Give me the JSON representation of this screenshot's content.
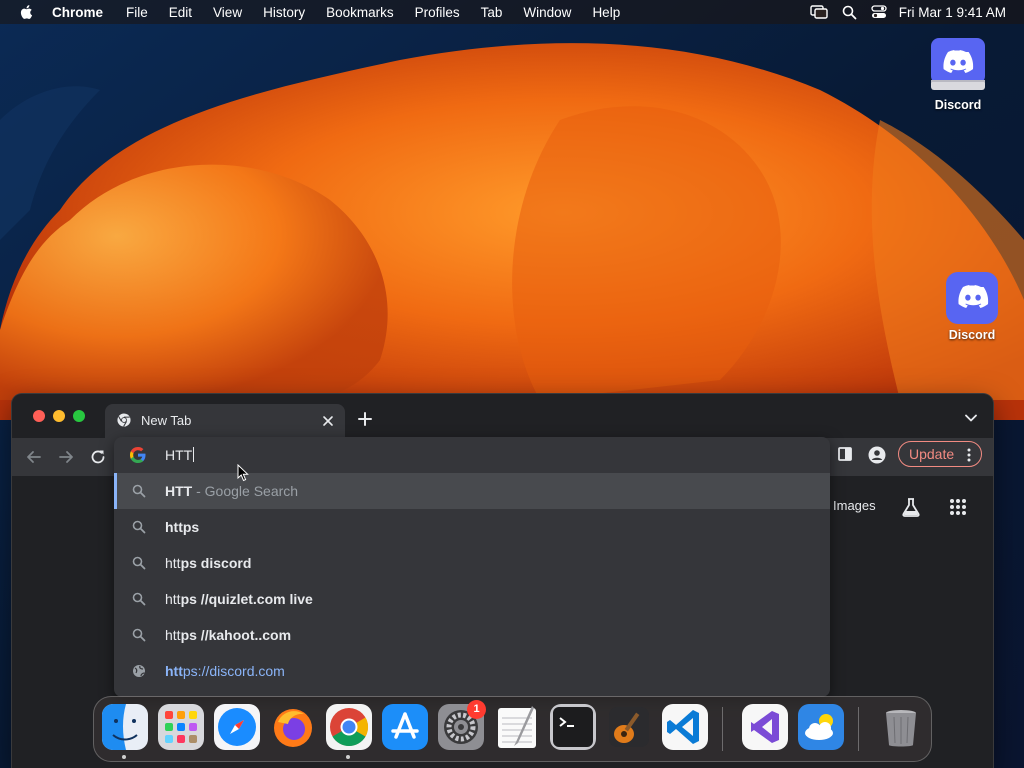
{
  "menubar": {
    "app": "Chrome",
    "items": [
      "File",
      "Edit",
      "View",
      "History",
      "Bookmarks",
      "Profiles",
      "Tab",
      "Window",
      "Help"
    ],
    "clock": "Fri Mar 1  9:41 AM"
  },
  "desktop": {
    "icons": [
      {
        "label": "Discord",
        "icon": "discord-drive-icon"
      },
      {
        "label": "Discord",
        "icon": "discord-app-icon"
      }
    ]
  },
  "chrome": {
    "tab_title": "New Tab",
    "omnibox": {
      "typed": "HTT",
      "suggestions": [
        {
          "bold": "HTT",
          "rest": " - Google Search",
          "type": "search",
          "selected": true
        },
        {
          "bold": "https",
          "rest": "",
          "type": "search"
        },
        {
          "plain": "htt",
          "bold": "ps discord",
          "type": "search"
        },
        {
          "plain": "htt",
          "bold": "ps //quizlet.com live",
          "type": "search"
        },
        {
          "plain": "htt",
          "bold": "ps //kahoot..com",
          "type": "search"
        },
        {
          "plain": "htt",
          "bold": "ps://discord.com",
          "type": "url"
        }
      ]
    },
    "update_label": "Update",
    "images_link": "Images"
  },
  "dock": {
    "apps": [
      "Finder",
      "Launchpad",
      "Safari",
      "Firefox",
      "Google Chrome",
      "App Store",
      "System Settings",
      "TextEdit",
      "Terminal",
      "GarageBand",
      "Visual Studio Code",
      "Visual Studio",
      "Weather",
      "Trash"
    ],
    "settings_badge": "1"
  },
  "colors": {
    "accent_link": "#8ab4f8",
    "update": "#f28b82",
    "toolbar": "#35363a",
    "window_bg": "#202124"
  }
}
